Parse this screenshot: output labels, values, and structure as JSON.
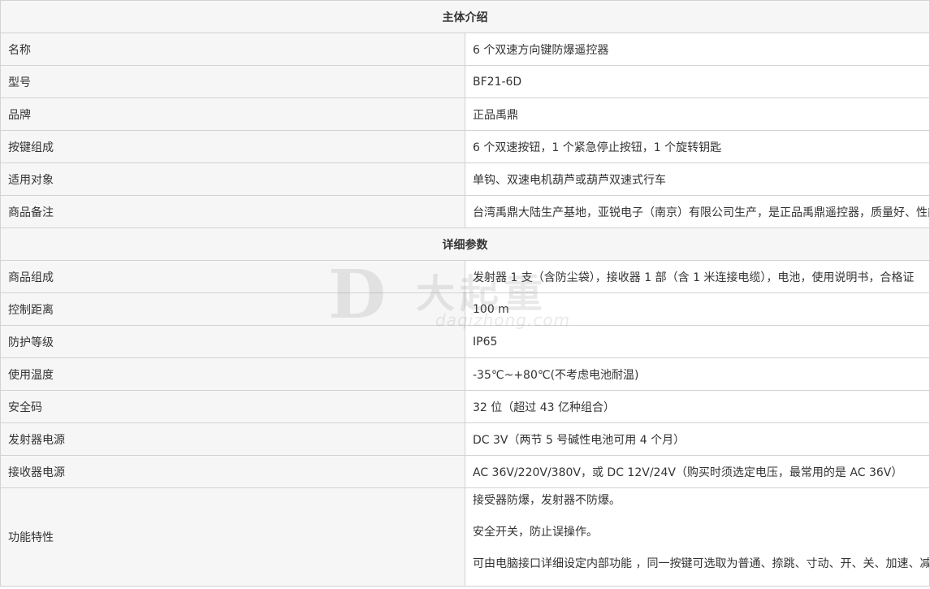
{
  "sections": [
    {
      "title": "主体介绍",
      "rows": [
        {
          "label": "名称",
          "value": "6 个双速方向键防爆遥控器"
        },
        {
          "label": "型号",
          "value": "BF21-6D"
        },
        {
          "label": "品牌",
          "value": "正品禹鼎"
        },
        {
          "label": "按键组成",
          "value": "6 个双速按钮，1 个紧急停止按钮，1 个旋转钥匙"
        },
        {
          "label": "适用对象",
          "value": "单钩、双速电机葫芦或葫芦双速式行车"
        },
        {
          "label": "商品备注",
          "value": "台湾禹鼎大陆生产基地，亚锐电子（南京）有限公司生产，是正品禹鼎遥控器，质量好、性能稳定。"
        }
      ]
    },
    {
      "title": "详细参数",
      "rows": [
        {
          "label": "商品组成",
          "value": "发射器 1 支（含防尘袋），接收器 1 部（含 1 米连接电缆），电池，使用说明书，合格证"
        },
        {
          "label": "控制距离",
          "value": "100 m"
        },
        {
          "label": "防护等级",
          "value": "IP65"
        },
        {
          "label": "使用温度",
          "value": "-35℃~+80℃(不考虑电池耐温)"
        },
        {
          "label": "安全码",
          "value": "32 位（超过 43 亿种组合）"
        },
        {
          "label": "发射器电源",
          "value": "DC 3V（两节 5 号碱性电池可用 4 个月）"
        },
        {
          "label": "接收器电源",
          "value": "AC 36V/220V/380V，或 DC 12V/24V（购买时须选定电压，最常用的是 AC 36V）"
        }
      ],
      "multiline_row": {
        "label": "功能特性",
        "lines": [
          "接受器防爆，发射器不防爆。",
          "安全开关，防止误操作。",
          "可由电脑接口详细设定内部功能 ，同一按键可选取为普通、捺跳、寸动、开、关、加速、减速等不同控制功能。"
        ]
      }
    }
  ],
  "watermark": {
    "logo": "D",
    "chinese": "大起重",
    "domain": "daqizhong.com"
  }
}
